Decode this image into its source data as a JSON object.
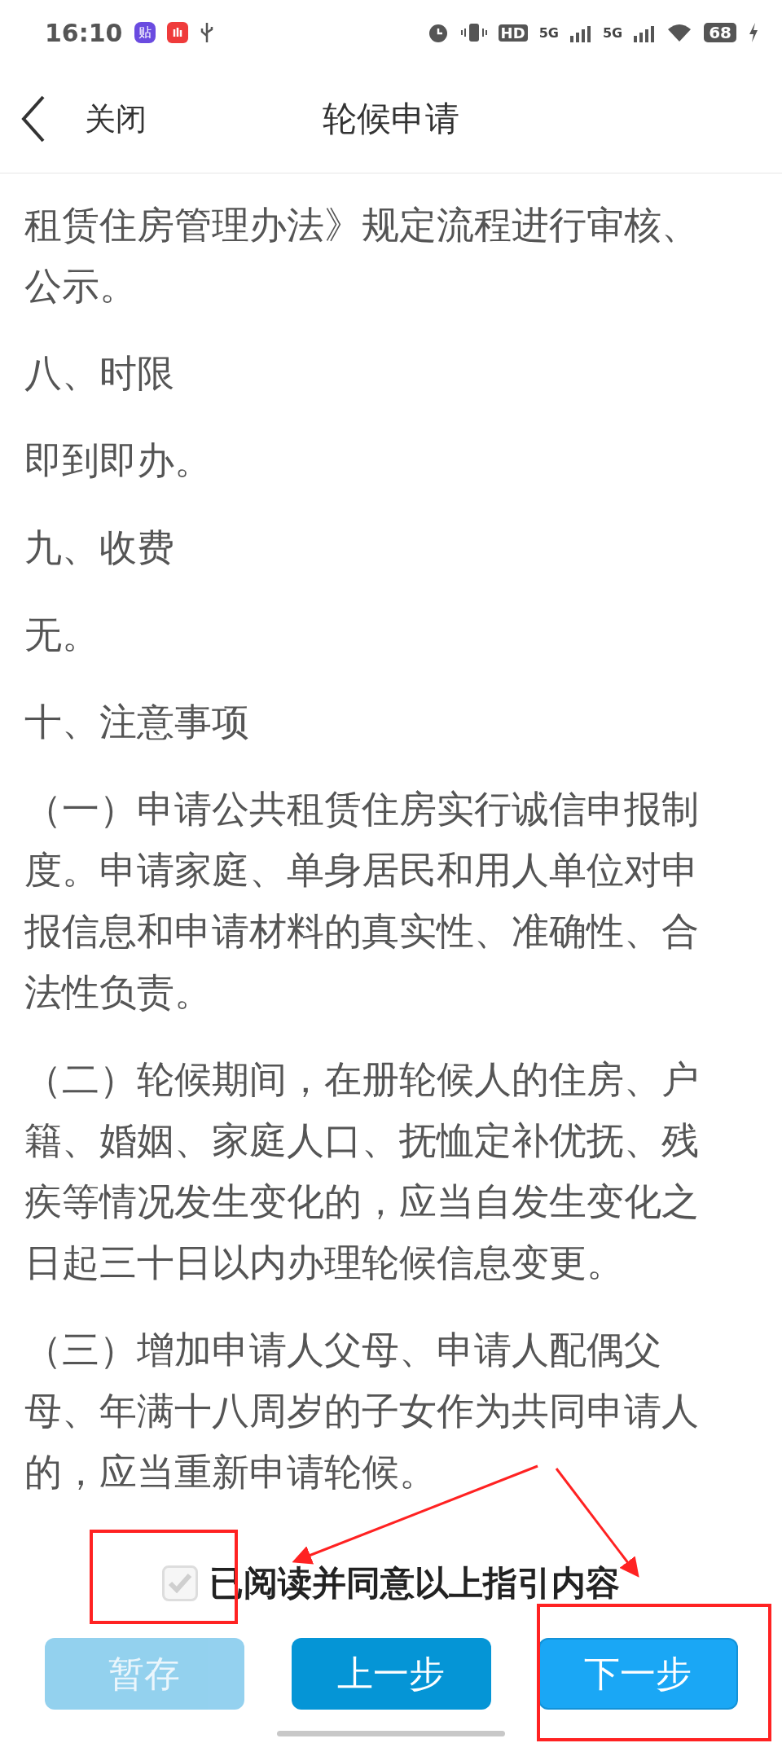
{
  "status_bar": {
    "time": "16:10",
    "app_badge": "贴",
    "hd": "HD",
    "networks": [
      "5G",
      "5G"
    ],
    "battery": "68"
  },
  "header": {
    "back": "关闭",
    "title": "轮候申请"
  },
  "paragraphs": [
    "租赁住房管理办法》规定流程进行审核、公示。",
    "八、时限",
    "即到即办。",
    "九、收费",
    "无。",
    "十、注意事项",
    "（一）申请公共租赁住房实行诚信申报制度。申请家庭、单身居民和用人单位对申报信息和申请材料的真实性、准确性、合法性负责。",
    "（二）轮候期间，在册轮候人的住房、户籍、婚姻、家庭人口、抚恤定补优抚、残疾等情况发生变化的，应当自发生变化之日起三十日以内办理轮候信息变更。",
    "（三）增加申请人父母、申请人配偶父母、年满十八周岁的子女作为共同申请人的，应当重新申请轮候。"
  ],
  "agreement": {
    "label": "已阅读并同意以上指引内容",
    "checked": true
  },
  "buttons": [
    {
      "label": "暂存",
      "kind": "save",
      "disabled": true
    },
    {
      "label": "上一步",
      "kind": "prev",
      "disabled": false
    },
    {
      "label": "下一步",
      "kind": "next",
      "disabled": false
    }
  ]
}
